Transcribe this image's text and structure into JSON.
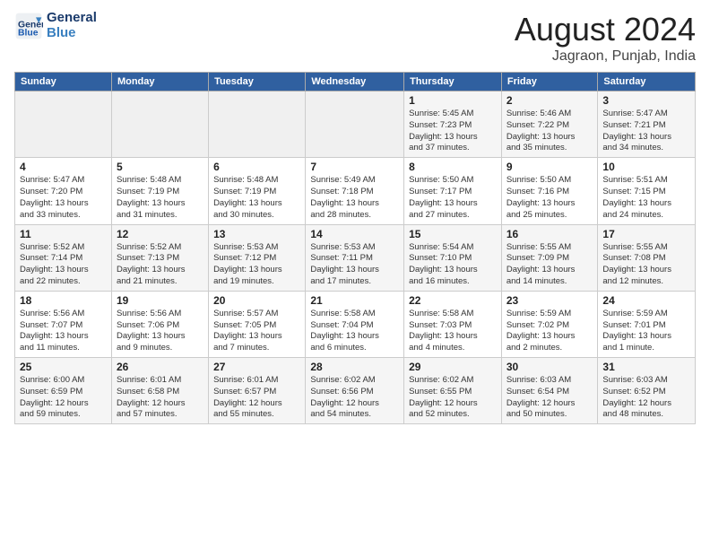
{
  "header": {
    "logo_line1": "General",
    "logo_line2": "Blue",
    "month": "August 2024",
    "location": "Jagraon, Punjab, India"
  },
  "weekdays": [
    "Sunday",
    "Monday",
    "Tuesday",
    "Wednesday",
    "Thursday",
    "Friday",
    "Saturday"
  ],
  "weeks": [
    [
      {
        "day": "",
        "text": ""
      },
      {
        "day": "",
        "text": ""
      },
      {
        "day": "",
        "text": ""
      },
      {
        "day": "",
        "text": ""
      },
      {
        "day": "1",
        "text": "Sunrise: 5:45 AM\nSunset: 7:23 PM\nDaylight: 13 hours\nand 37 minutes."
      },
      {
        "day": "2",
        "text": "Sunrise: 5:46 AM\nSunset: 7:22 PM\nDaylight: 13 hours\nand 35 minutes."
      },
      {
        "day": "3",
        "text": "Sunrise: 5:47 AM\nSunset: 7:21 PM\nDaylight: 13 hours\nand 34 minutes."
      }
    ],
    [
      {
        "day": "4",
        "text": "Sunrise: 5:47 AM\nSunset: 7:20 PM\nDaylight: 13 hours\nand 33 minutes."
      },
      {
        "day": "5",
        "text": "Sunrise: 5:48 AM\nSunset: 7:19 PM\nDaylight: 13 hours\nand 31 minutes."
      },
      {
        "day": "6",
        "text": "Sunrise: 5:48 AM\nSunset: 7:19 PM\nDaylight: 13 hours\nand 30 minutes."
      },
      {
        "day": "7",
        "text": "Sunrise: 5:49 AM\nSunset: 7:18 PM\nDaylight: 13 hours\nand 28 minutes."
      },
      {
        "day": "8",
        "text": "Sunrise: 5:50 AM\nSunset: 7:17 PM\nDaylight: 13 hours\nand 27 minutes."
      },
      {
        "day": "9",
        "text": "Sunrise: 5:50 AM\nSunset: 7:16 PM\nDaylight: 13 hours\nand 25 minutes."
      },
      {
        "day": "10",
        "text": "Sunrise: 5:51 AM\nSunset: 7:15 PM\nDaylight: 13 hours\nand 24 minutes."
      }
    ],
    [
      {
        "day": "11",
        "text": "Sunrise: 5:52 AM\nSunset: 7:14 PM\nDaylight: 13 hours\nand 22 minutes."
      },
      {
        "day": "12",
        "text": "Sunrise: 5:52 AM\nSunset: 7:13 PM\nDaylight: 13 hours\nand 21 minutes."
      },
      {
        "day": "13",
        "text": "Sunrise: 5:53 AM\nSunset: 7:12 PM\nDaylight: 13 hours\nand 19 minutes."
      },
      {
        "day": "14",
        "text": "Sunrise: 5:53 AM\nSunset: 7:11 PM\nDaylight: 13 hours\nand 17 minutes."
      },
      {
        "day": "15",
        "text": "Sunrise: 5:54 AM\nSunset: 7:10 PM\nDaylight: 13 hours\nand 16 minutes."
      },
      {
        "day": "16",
        "text": "Sunrise: 5:55 AM\nSunset: 7:09 PM\nDaylight: 13 hours\nand 14 minutes."
      },
      {
        "day": "17",
        "text": "Sunrise: 5:55 AM\nSunset: 7:08 PM\nDaylight: 13 hours\nand 12 minutes."
      }
    ],
    [
      {
        "day": "18",
        "text": "Sunrise: 5:56 AM\nSunset: 7:07 PM\nDaylight: 13 hours\nand 11 minutes."
      },
      {
        "day": "19",
        "text": "Sunrise: 5:56 AM\nSunset: 7:06 PM\nDaylight: 13 hours\nand 9 minutes."
      },
      {
        "day": "20",
        "text": "Sunrise: 5:57 AM\nSunset: 7:05 PM\nDaylight: 13 hours\nand 7 minutes."
      },
      {
        "day": "21",
        "text": "Sunrise: 5:58 AM\nSunset: 7:04 PM\nDaylight: 13 hours\nand 6 minutes."
      },
      {
        "day": "22",
        "text": "Sunrise: 5:58 AM\nSunset: 7:03 PM\nDaylight: 13 hours\nand 4 minutes."
      },
      {
        "day": "23",
        "text": "Sunrise: 5:59 AM\nSunset: 7:02 PM\nDaylight: 13 hours\nand 2 minutes."
      },
      {
        "day": "24",
        "text": "Sunrise: 5:59 AM\nSunset: 7:01 PM\nDaylight: 13 hours\nand 1 minute."
      }
    ],
    [
      {
        "day": "25",
        "text": "Sunrise: 6:00 AM\nSunset: 6:59 PM\nDaylight: 12 hours\nand 59 minutes."
      },
      {
        "day": "26",
        "text": "Sunrise: 6:01 AM\nSunset: 6:58 PM\nDaylight: 12 hours\nand 57 minutes."
      },
      {
        "day": "27",
        "text": "Sunrise: 6:01 AM\nSunset: 6:57 PM\nDaylight: 12 hours\nand 55 minutes."
      },
      {
        "day": "28",
        "text": "Sunrise: 6:02 AM\nSunset: 6:56 PM\nDaylight: 12 hours\nand 54 minutes."
      },
      {
        "day": "29",
        "text": "Sunrise: 6:02 AM\nSunset: 6:55 PM\nDaylight: 12 hours\nand 52 minutes."
      },
      {
        "day": "30",
        "text": "Sunrise: 6:03 AM\nSunset: 6:54 PM\nDaylight: 12 hours\nand 50 minutes."
      },
      {
        "day": "31",
        "text": "Sunrise: 6:03 AM\nSunset: 6:52 PM\nDaylight: 12 hours\nand 48 minutes."
      }
    ]
  ]
}
